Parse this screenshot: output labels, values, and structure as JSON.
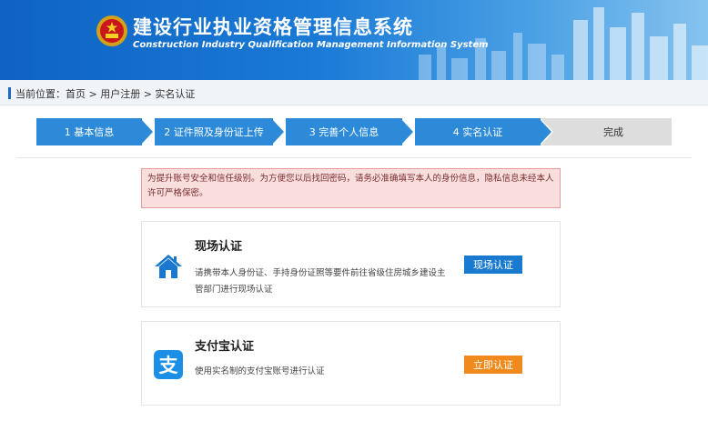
{
  "header": {
    "title_cn": "建设行业执业资格管理信息系统",
    "title_en": "Construction Industry Qualification Management Information System"
  },
  "breadcrumb": {
    "text": "当前位置：首页 > 用户注册 > 实名认证"
  },
  "steps": [
    {
      "label": "1 基本信息",
      "state": "done"
    },
    {
      "label": "2 证件照及身份证上传",
      "state": "done"
    },
    {
      "label": "3 完善个人信息",
      "state": "done"
    },
    {
      "label": "4 实名认证",
      "state": "current"
    },
    {
      "label": "完成",
      "state": "todo"
    }
  ],
  "notice": {
    "text": "为提升账号安全和信任级别。为方便您以后找回密码，请务必准确填写本人的身份信息，隐私信息未经本人许可严格保密。"
  },
  "options": [
    {
      "title": "现场认证",
      "description": "请携带本人身份证、手持身份证照等要件前往省级住房城乡建设主管部门进行现场认证",
      "button_label": "现场认证",
      "icon": "home-icon"
    },
    {
      "title": "支付宝认证",
      "description": "使用实名制的支付宝账号进行认证",
      "button_label": "立即认证",
      "icon": "alipay-icon"
    }
  ],
  "colors": {
    "header_blue": "#1a7ad6",
    "step_blue": "#2c8ad8",
    "button_blue": "#1a7ad0",
    "button_orange": "#f08a1c",
    "notice_bg": "#f9dede"
  }
}
